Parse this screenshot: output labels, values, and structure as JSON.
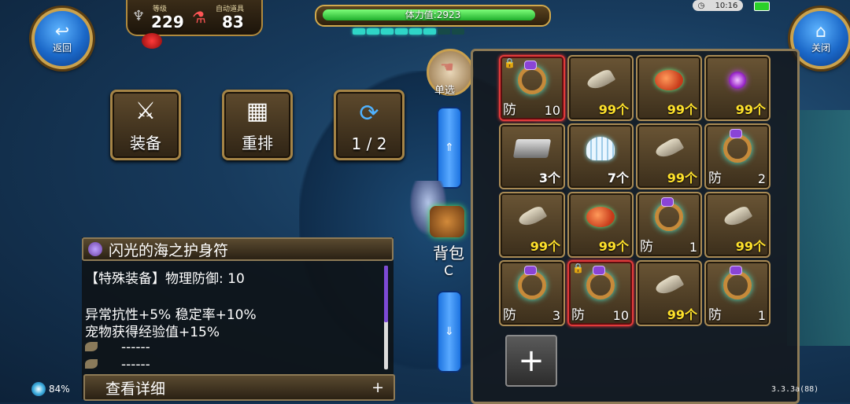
{
  "top_left": {
    "back_label": "返回"
  },
  "top_right": {
    "close_label": "关闭"
  },
  "stats": {
    "level_label": "等级",
    "level_value": "229",
    "auto_item_label": "自动道具",
    "auto_item_value": "83"
  },
  "stamina": {
    "text": "体力值:2923",
    "fill_fraction": 0.97,
    "segments_lit": 6,
    "segments_total": 8
  },
  "status": {
    "time": "10:16"
  },
  "actions": {
    "equip_label": "装备",
    "sort_label": "重排",
    "page_label": "1 / 2"
  },
  "single_select_label": "单选",
  "bag": {
    "label": "背包",
    "shortcut": "C"
  },
  "inventory": {
    "slots": [
      {
        "icon": "ring-with-gems-icon",
        "tag": "防",
        "level": "10",
        "locked": true,
        "red": true
      },
      {
        "icon": "claw-icon",
        "qty": "99个"
      },
      {
        "icon": "meat-icon",
        "qty": "99个"
      },
      {
        "icon": "purple-orb-icon",
        "qty": "99个"
      },
      {
        "icon": "iron-ingot-icon",
        "qty": "3个",
        "qty_white": true
      },
      {
        "icon": "seashell-icon",
        "qty": "7个",
        "qty_white": true
      },
      {
        "icon": "claw-icon",
        "qty": "99个"
      },
      {
        "icon": "ring-icon",
        "tag": "防",
        "level": "2"
      },
      {
        "icon": "claw-icon",
        "qty": "99个"
      },
      {
        "icon": "meat-icon",
        "qty": "99个"
      },
      {
        "icon": "ring-icon",
        "tag": "防",
        "level": "1"
      },
      {
        "icon": "claw-icon",
        "qty": "99个"
      },
      {
        "icon": "ring-icon",
        "tag": "防",
        "level": "3"
      },
      {
        "icon": "ring-with-feather-icon",
        "tag": "防",
        "level": "10",
        "locked": true,
        "red": true
      },
      {
        "icon": "claw-icon",
        "qty": "99个"
      },
      {
        "icon": "ring-icon",
        "tag": "防",
        "level": "1"
      }
    ],
    "add_slot_symbol": "+"
  },
  "detail": {
    "title": "闪光的海之护身符",
    "line1": "【特殊装备】物理防御: 10",
    "line2": "异常抗性+5% 稳定率+10%",
    "line3": "宠物获得经验值+15%",
    "line4": "------",
    "line5": "------",
    "view_more": "查看详细",
    "view_more_plus": "+"
  },
  "footer": {
    "battery": "84%",
    "version": "3.3.3a(88)"
  }
}
